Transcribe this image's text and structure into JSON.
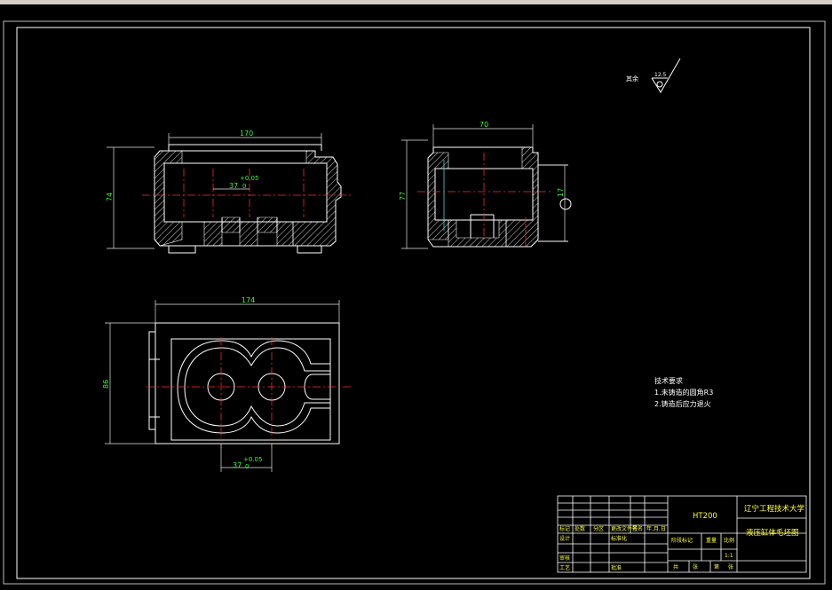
{
  "dimensions": {
    "front_width": "170",
    "front_height": "74",
    "front_bore": "37",
    "front_tol_upper": "+0.05",
    "front_tol_lower": "0",
    "side_width": "70",
    "side_height": "77",
    "side_small": "17",
    "plan_width": "174",
    "plan_height": "86",
    "plan_bore": "37",
    "plan_tol_upper": "+0.05",
    "plan_tol_lower": "0"
  },
  "surface_finish": {
    "label": "其余",
    "value": "12.5"
  },
  "tech_requirements": {
    "title": "技术要求",
    "item1": "1.未铸造的圆角R3",
    "item2": "2.铸造后应力退火"
  },
  "title_block": {
    "material": "HT200",
    "school": "辽宁工程技术大学",
    "drawing_name": "液压缸体毛坯图",
    "scale": "1:1",
    "col_mark": "标记",
    "col_count": "处数",
    "col_zone": "分区",
    "col_change_doc": "更改文件号",
    "col_sign": "签名",
    "col_date": "年.月.日",
    "row_design": "设计",
    "row_standard": "标准化",
    "row_check": "审核",
    "row_process": "工艺",
    "row_approve": "批准",
    "stage_label": "阶段标记",
    "weight_label": "重量",
    "scale_label": "比例",
    "sheets_total": "共",
    "sheet_label": "张",
    "sheet_no": "第",
    "sheet_unit": "张"
  }
}
